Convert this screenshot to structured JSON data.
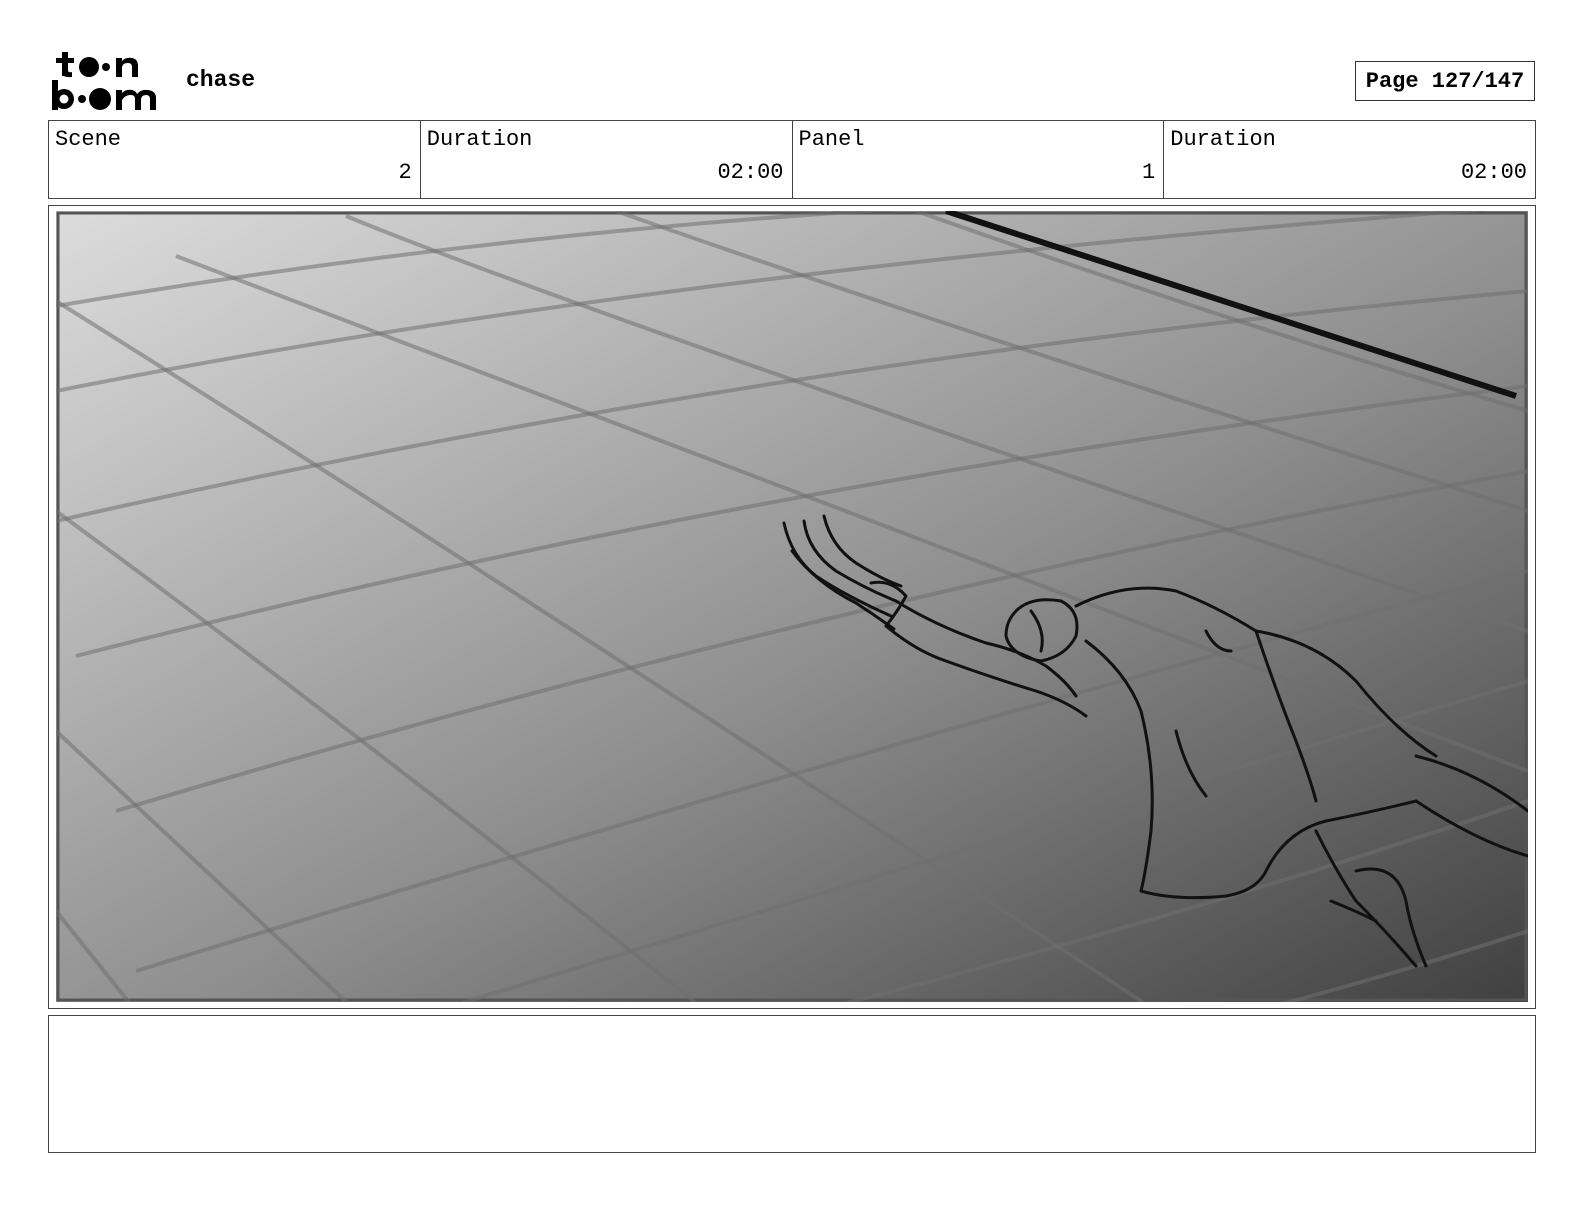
{
  "header": {
    "logo_name": "toon-boom-logo",
    "project_title": "chase",
    "page_label": "Page 127/147"
  },
  "info": {
    "scene_label": "Scene",
    "scene_value": "2",
    "scene_duration_label": "Duration",
    "scene_duration_value": "02:00",
    "panel_label": "Panel",
    "panel_value": "1",
    "panel_duration_label": "Duration",
    "panel_duration_value": "02:00"
  },
  "panel": {
    "description_icon": "storyboard-sketch-figure-falling-on-tiled-floor"
  },
  "notes": {
    "text": ""
  },
  "colors": {
    "border": "#444444",
    "sketch_light": "#dcdcdc",
    "sketch_dark": "#404040"
  }
}
